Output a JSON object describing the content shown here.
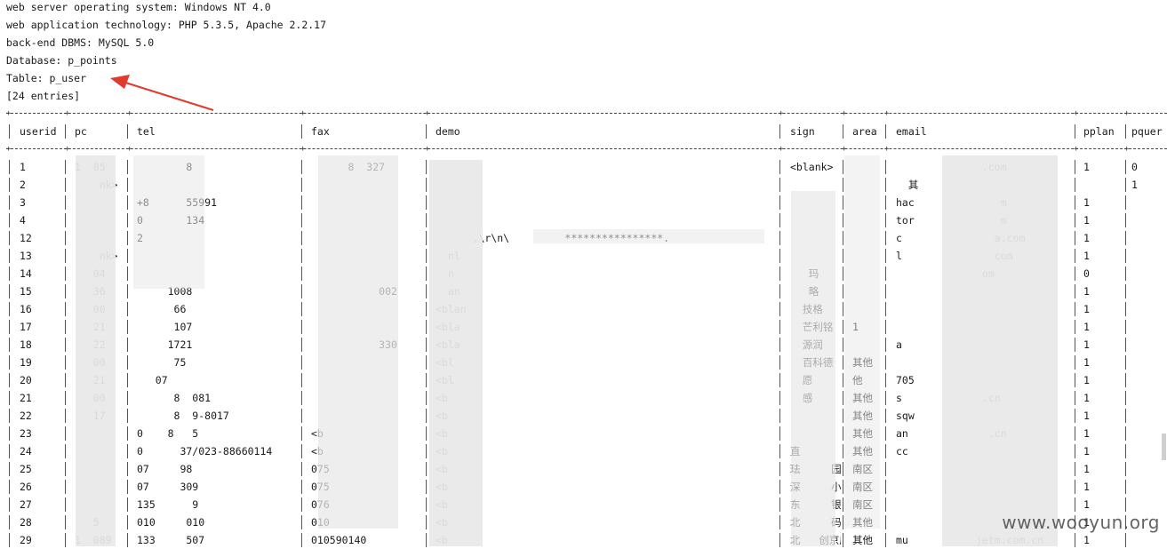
{
  "header_lines": [
    "web server operating system: Windows NT 4.0",
    "web application technology: PHP 5.3.5, Apache 2.2.17",
    "back-end DBMS: MySQL 5.0",
    "Database: p_points",
    "Table: p_user",
    "[24 entries]"
  ],
  "columns": [
    "userid",
    "pc",
    "tel",
    "fax",
    "demo",
    "sign",
    "area",
    "email",
    "pplan",
    "pquer"
  ],
  "rows": [
    [
      "1",
      "1  85",
      "        8        ",
      "      8  327",
      "",
      "<blank>",
      "",
      "              .com",
      "1",
      "0"
    ],
    [
      "2",
      "    nk>",
      "",
      "",
      "",
      "",
      "",
      "  其",
      "",
      "1"
    ],
    [
      "3",
      "",
      "+8      55991",
      "",
      "",
      "",
      "",
      "hac              m",
      "1",
      ""
    ],
    [
      "4",
      "",
      "0       134",
      "",
      "",
      "",
      "",
      "tor              m",
      "1",
      ""
    ],
    [
      "12",
      "",
      "2",
      "",
      "      ,\\r\\n\\         ****************.",
      "",
      "",
      "c               a.com",
      "1",
      ""
    ],
    [
      "13",
      "    nk>",
      "",
      "",
      "  nl",
      "",
      "",
      "l               com",
      "1",
      ""
    ],
    [
      "14",
      "   04",
      "",
      "",
      "  n",
      "   玛",
      "",
      "              om",
      "0",
      ""
    ],
    [
      "15",
      "   36",
      "     1008",
      "           002",
      "  an",
      "   略",
      "",
      "",
      "1",
      ""
    ],
    [
      "16",
      "   00",
      "      66",
      "",
      "<blan",
      "  技格",
      "",
      "",
      "1",
      ""
    ],
    [
      "17",
      "   21",
      "      107",
      "",
      "<bla",
      "  芒利铭",
      "1",
      "",
      "1",
      ""
    ],
    [
      "18",
      "   22",
      "     1721",
      "           330",
      "<bla",
      "  源润",
      "",
      "a",
      "1",
      ""
    ],
    [
      "19",
      "   00",
      "      75",
      "",
      "<bl",
      "  百科德",
      "其他",
      "",
      "1",
      ""
    ],
    [
      "20",
      "   21",
      "   07",
      "",
      "<bl",
      "  愿",
      "他",
      "705",
      "1",
      ""
    ],
    [
      "21",
      "   00",
      "      8  081",
      "",
      "<b",
      "  感",
      "其他",
      "s             .cn",
      "1",
      ""
    ],
    [
      "22",
      "   17",
      "      8  9-8017",
      "",
      "<b",
      "   ",
      "其他",
      "sqw",
      "1",
      ""
    ],
    [
      "23",
      "",
      "0    8   5",
      "<b",
      "<b",
      "",
      "其他",
      "an             .cn",
      "1",
      ""
    ],
    [
      "24",
      "",
      "0      37/023-88660114",
      "<b",
      "<b",
      "直",
      "其他",
      "cc",
      "1",
      ""
    ],
    [
      "25",
      "",
      "07     98",
      "075",
      "<b",
      "珐     园",
      "南区",
      "",
      "1",
      ""
    ],
    [
      "26",
      "",
      "07     309",
      "075",
      "<b",
      "深     小",
      "南区",
      "",
      "1",
      ""
    ],
    [
      "27",
      "",
      "135      9",
      "076",
      "<b",
      "东     银",
      "南区",
      "",
      "1",
      ""
    ],
    [
      "28",
      "   5",
      "010     010",
      "010",
      "<b",
      "北     码",
      "其他",
      "",
      "1",
      ""
    ],
    [
      "29",
      "1  089",
      "133     507",
      "010590140",
      "<b",
      "北   创京成",
      "其他",
      "mu           jetm.com.cn",
      "1",
      ""
    ]
  ],
  "watermark": "www.wooyun.org"
}
